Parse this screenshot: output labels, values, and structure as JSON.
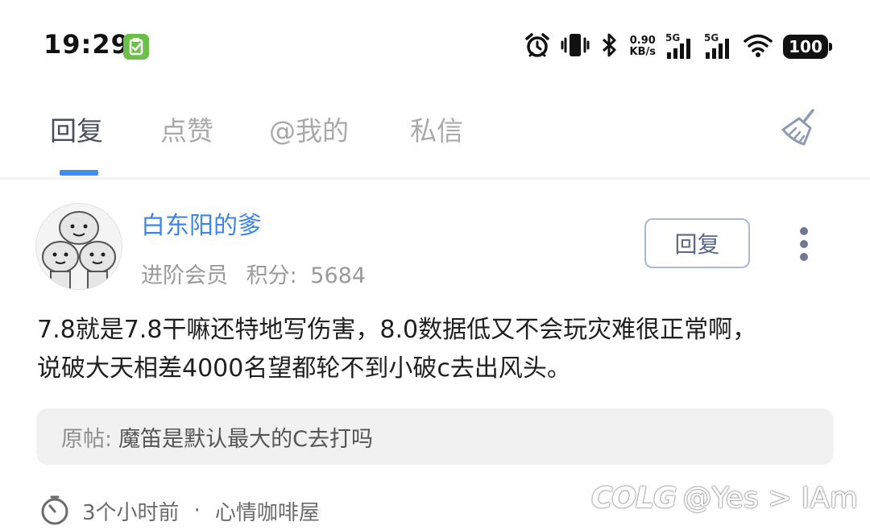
{
  "status_bar": {
    "time": "19:29",
    "net_speed_value": "0.90",
    "net_speed_unit": "KB/s",
    "sim1_label": "5G",
    "sim2_label": "5G",
    "battery": "100",
    "icons": [
      "alarm-icon",
      "vibrate-icon",
      "bluetooth-icon",
      "signal-icon",
      "wifi-icon",
      "battery-icon"
    ]
  },
  "tabs": [
    {
      "label": "回复",
      "active": true
    },
    {
      "label": "点赞",
      "active": false
    },
    {
      "label": "@我的",
      "active": false
    },
    {
      "label": "私信",
      "active": false
    }
  ],
  "reply": {
    "username": "白东阳的爹",
    "level": "进阶会员",
    "points_label": "积分:",
    "points_value": "5684",
    "reply_button_label": "回复",
    "content_lines": [
      "7.8就是7.8干嘛还特地写伤害，8.0数据低又不会玩灾难很正常啊，",
      "说破大天相差4000名望都轮不到小破c去出风头。"
    ],
    "quote_label": "原帖:",
    "quote_text": "魔笛是默认最大的C去打吗",
    "time_ago": "3个小时前",
    "separator": "·",
    "forum": "心情咖啡屋"
  },
  "watermark": {
    "logo": "COLG",
    "text": "@Yes > IAm"
  },
  "colors": {
    "accent": "#3d8ef0",
    "username": "#3d86e6",
    "tab_active": "#4a4f5e",
    "tab_inactive": "#a9a9a9"
  }
}
